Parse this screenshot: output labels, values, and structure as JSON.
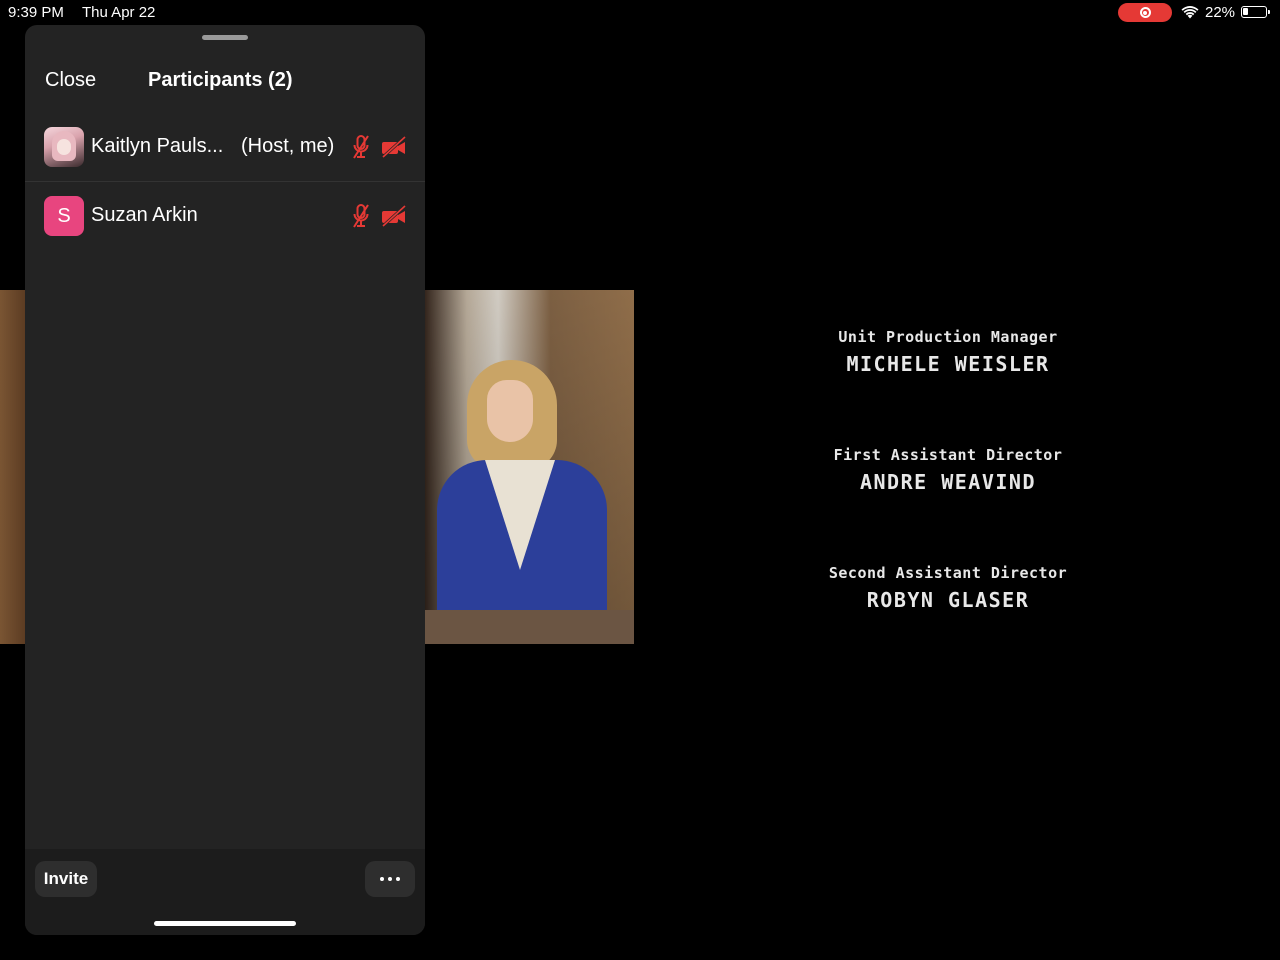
{
  "status_bar": {
    "time": "9:39 PM",
    "date": "Thu Apr 22",
    "battery_percent": "22%",
    "battery_level": 0.22,
    "recording_color": "#e53935"
  },
  "panel": {
    "close_label": "Close",
    "title": "Participants (2)",
    "participants": [
      {
        "name": "Kaitlyn Pauls...",
        "role": "(Host, me)",
        "avatar": "photo",
        "mic": "muted",
        "camera": "off"
      },
      {
        "name": "Suzan Arkin",
        "role": "",
        "avatar_letter": "S",
        "avatar_color": "#e8457f",
        "mic": "muted",
        "camera": "off"
      }
    ],
    "invite_label": "Invite",
    "more_icon": "more-dots-icon",
    "mute_color": "#e53935"
  },
  "shared_screen": {
    "credits": [
      {
        "role": "Unit Production Manager",
        "name": "MICHELE WEISLER"
      },
      {
        "role": "First Assistant Director",
        "name": "ANDRE WEAVIND"
      },
      {
        "role": "Second Assistant Director",
        "name": "ROBYN GLASER"
      }
    ]
  }
}
